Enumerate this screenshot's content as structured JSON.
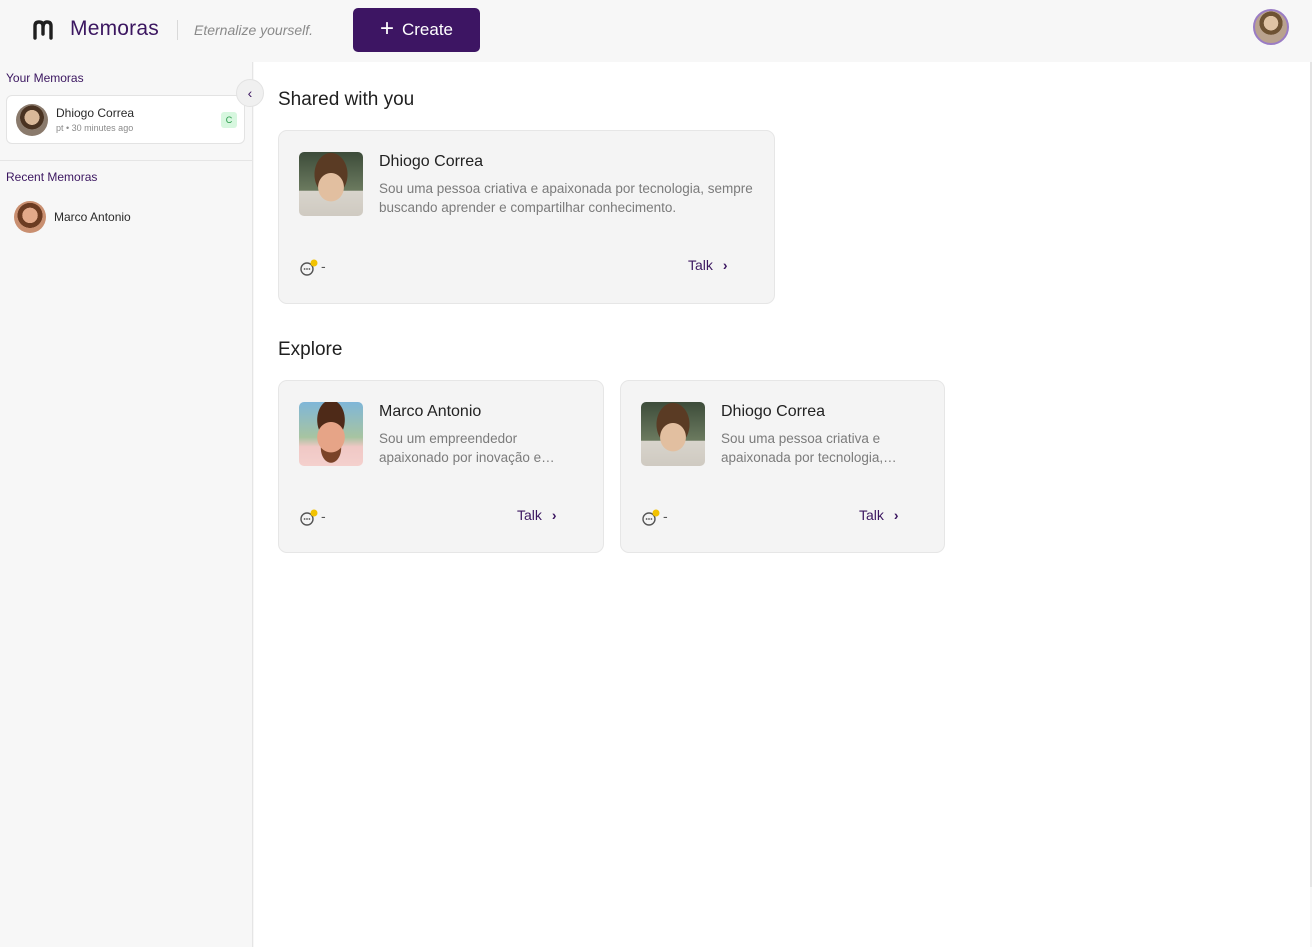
{
  "header": {
    "brand": "Memoras",
    "tagline": "Eternalize yourself.",
    "create_label": "Create",
    "create_icon": "+"
  },
  "sidebar": {
    "your_title": "Your Memoras",
    "collapse_icon": "‹",
    "your_memoras": [
      {
        "name": "Dhiogo Correa",
        "meta": "pt • 30 minutes ago",
        "badge": "C"
      }
    ],
    "recent_title": "Recent Memoras",
    "recent_memoras": [
      {
        "name": "Marco Antonio"
      }
    ]
  },
  "main": {
    "shared_title": "Shared with you",
    "shared_cards": [
      {
        "name": "Dhiogo Correa",
        "description": "Sou uma pessoa criativa e apaixonada por tecnologia, sempre buscando aprender e compartilhar conhecimento.",
        "count": "-",
        "talk_label": "Talk"
      }
    ],
    "explore_title": "Explore",
    "explore_cards": [
      {
        "name": "Marco Antonio",
        "description": "Sou um empreendedor apaixonado por inovação e tecnologia.",
        "count": "-",
        "talk_label": "Talk"
      },
      {
        "name": "Dhiogo Correa",
        "description": "Sou uma pessoa criativa e apaixonada por tecnologia, sempre buscando aprender.",
        "count": "-",
        "talk_label": "Talk"
      }
    ]
  },
  "colors": {
    "brand_purple": "#3d1563",
    "status_dot": "#f2c200",
    "badge_green": "#d7f7df"
  }
}
